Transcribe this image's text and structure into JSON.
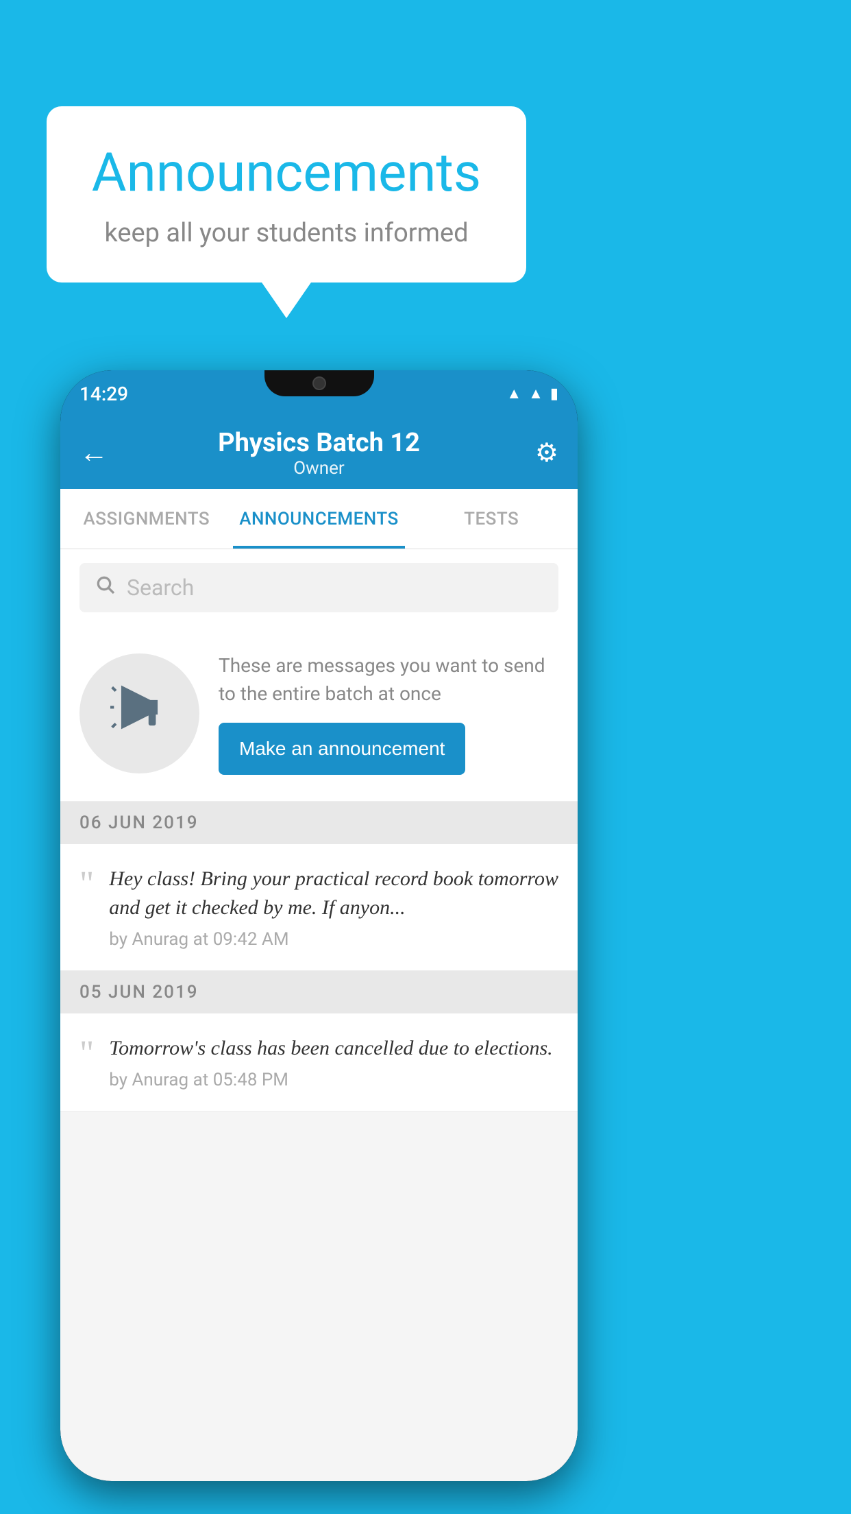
{
  "background_color": "#1ab8e8",
  "bubble": {
    "title": "Announcements",
    "subtitle": "keep all your students informed"
  },
  "status_bar": {
    "time": "14:29",
    "wifi_icon": "wifi-icon",
    "signal_icon": "signal-icon",
    "battery_icon": "battery-icon"
  },
  "toolbar": {
    "back_icon": "←",
    "title": "Physics Batch 12",
    "subtitle": "Owner",
    "settings_icon": "⚙"
  },
  "tabs": [
    {
      "label": "ASSIGNMENTS",
      "active": false
    },
    {
      "label": "ANNOUNCEMENTS",
      "active": true
    },
    {
      "label": "TESTS",
      "active": false
    }
  ],
  "search": {
    "placeholder": "Search"
  },
  "announcement_prompt": {
    "description": "These are messages you want to send to the entire batch at once",
    "button_label": "Make an announcement"
  },
  "announcements": [
    {
      "date": "06  JUN  2019",
      "text": "Hey class! Bring your practical record book tomorrow and get it checked by me. If anyon...",
      "meta": "by Anurag at 09:42 AM"
    },
    {
      "date": "05  JUN  2019",
      "text": "Tomorrow's class has been cancelled due to elections.",
      "meta": "by Anurag at 05:48 PM"
    }
  ]
}
